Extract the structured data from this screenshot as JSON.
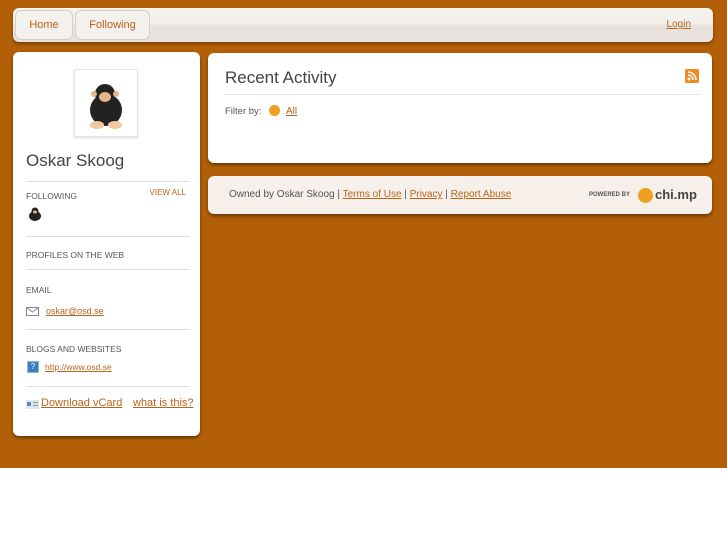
{
  "nav": {
    "tabs": [
      {
        "label": "Home"
      },
      {
        "label": "Following"
      }
    ],
    "login": "Login"
  },
  "profile": {
    "name": "Oskar Skoog",
    "following_label": "FOLLOWING",
    "view_all": "VIEW ALL",
    "profiles_label": "PROFILES ON THE WEB",
    "email_label": "EMAIL",
    "email": "oskar@osd.se",
    "blogs_label": "BLOGS AND WEBSITES",
    "website": "http://www.osd.se",
    "download_vcard": "Download vCard",
    "what_is_this": "what is this?"
  },
  "activity": {
    "title": "Recent Activity",
    "filter_label": "Filter by:",
    "filter_all": "All"
  },
  "footer": {
    "owned_by": "Owned by Oskar Skoog",
    "sep": "|",
    "terms": "Terms of Use",
    "privacy": "Privacy",
    "report": "Report Abuse",
    "powered_by": "POWERED BY",
    "brand": "chi.mp"
  },
  "colors": {
    "background": "#b25f07",
    "link": "#b8641a"
  }
}
